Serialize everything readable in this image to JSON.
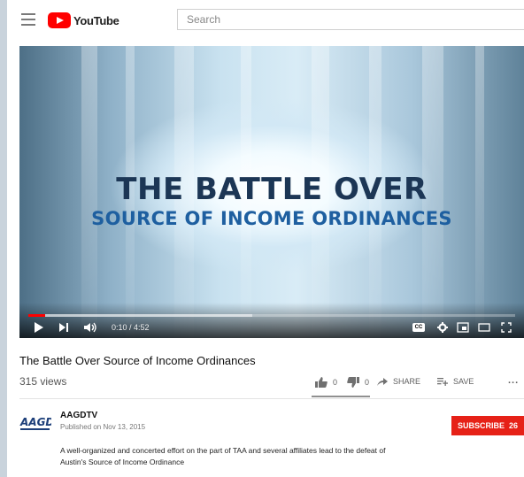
{
  "header": {
    "logo_text": "YouTube",
    "search_placeholder": "Search"
  },
  "video": {
    "title_line1": "THE BATTLE OVER",
    "title_line2": "SOURCE OF INCOME ORDINANCES",
    "time_display": "0:10 / 4:52",
    "progress_fraction": 0.035,
    "cc_label": "CC"
  },
  "info": {
    "title": "The Battle Over Source of Income Ordinances",
    "views": "315 views",
    "likes": "0",
    "dislikes": "0",
    "share_label": "SHARE",
    "save_label": "SAVE",
    "more_label": "..."
  },
  "channel": {
    "logo_text": "AAGD",
    "name": "AAGDTV",
    "published": "Published on Nov 13, 2015",
    "subscribe_label": "SUBSCRIBE",
    "subscriber_count": "26"
  },
  "description": {
    "line1": "A well-organized and concerted effort on the part of TAA and several affiliates lead to the defeat of",
    "line2": "Austin's Source of Income Ordinance"
  },
  "colors": {
    "brand_red": "#ff0000",
    "subscribe_red": "#e62117",
    "title_navy": "#1c3655",
    "subtitle_blue": "#1e5fa0"
  }
}
